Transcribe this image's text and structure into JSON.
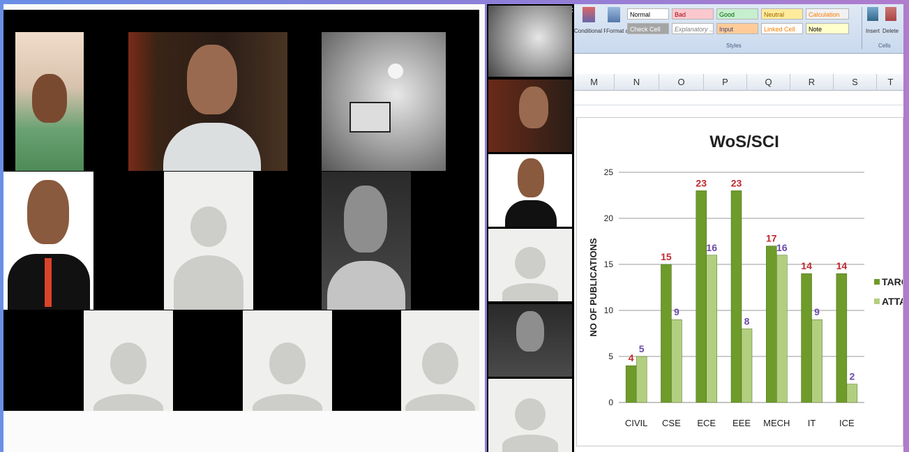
{
  "toolbar": {
    "popout_label": "⧉",
    "close_label": "×"
  },
  "ribbon": {
    "styles": [
      "Normal",
      "Bad",
      "Good",
      "Neutral",
      "Calculation",
      "Check Cell",
      "Explanatory ...",
      "Input",
      "Linked Cell",
      "Note"
    ],
    "conditional_formatting": "Conditional Formatting",
    "format_as_table": "Format as Table",
    "styles_group": "Styles",
    "insert": "Insert",
    "delete": "Delete",
    "cells_group": "Cells"
  },
  "columns": [
    "M",
    "N",
    "O",
    "P",
    "Q",
    "R",
    "S",
    "T"
  ],
  "chart_data": {
    "type": "bar",
    "title": "WoS/SCI",
    "ylabel": "NO OF PUBLICATIONS",
    "xlabel": "",
    "ylim": [
      0,
      25
    ],
    "yticks": [
      0,
      5,
      10,
      15,
      20,
      25
    ],
    "categories": [
      "CIVIL",
      "CSE",
      "ECE",
      "EEE",
      "MECH",
      "IT",
      "ICE"
    ],
    "series": [
      {
        "name": "TARG",
        "values": [
          4,
          15,
          23,
          23,
          17,
          14,
          14
        ],
        "color": "#6e9b2a",
        "label_color": "#c0282d"
      },
      {
        "name": "ATTA",
        "values": [
          5,
          9,
          16,
          8,
          16,
          9,
          2
        ],
        "color": "#b2cf80",
        "label_color": "#6a4aa8"
      }
    ],
    "legend": "right",
    "grid": true
  },
  "colors": {
    "bg_left": "#6a8fe6",
    "bg_right": "#b07ccd",
    "placeholder": "#efefed",
    "avatar_shape": "#cdcdca"
  }
}
